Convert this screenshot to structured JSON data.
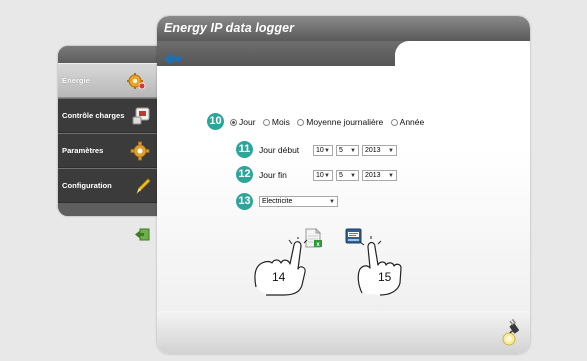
{
  "window": {
    "title": "Energy IP data logger"
  },
  "sidebar": {
    "items": [
      {
        "label": "Énergie",
        "icon": "energy-gear-icon",
        "active": true
      },
      {
        "label": "Contrôle charges",
        "icon": "load-control-icon",
        "active": false
      },
      {
        "label": "Paramètres",
        "icon": "gear-icon",
        "active": false
      },
      {
        "label": "Configuration",
        "icon": "pencil-icon",
        "active": false
      }
    ]
  },
  "form": {
    "period": {
      "badge": "10",
      "options": [
        "Jour",
        "Mois",
        "Moyenne journalière",
        "Année"
      ],
      "selected": "Jour"
    },
    "start": {
      "badge": "11",
      "label": "Jour début",
      "day": "10",
      "month": "5",
      "year": "2013"
    },
    "end": {
      "badge": "12",
      "label": "Jour fin",
      "day": "10",
      "month": "5",
      "year": "2013"
    },
    "type": {
      "badge": "13",
      "value": "Electricite"
    }
  },
  "callouts": {
    "export": "14",
    "print": "15"
  },
  "colors": {
    "accent": "#2ea59a",
    "title_bar": "#6d6d6d",
    "back_arrow": "#1f6fb2"
  }
}
